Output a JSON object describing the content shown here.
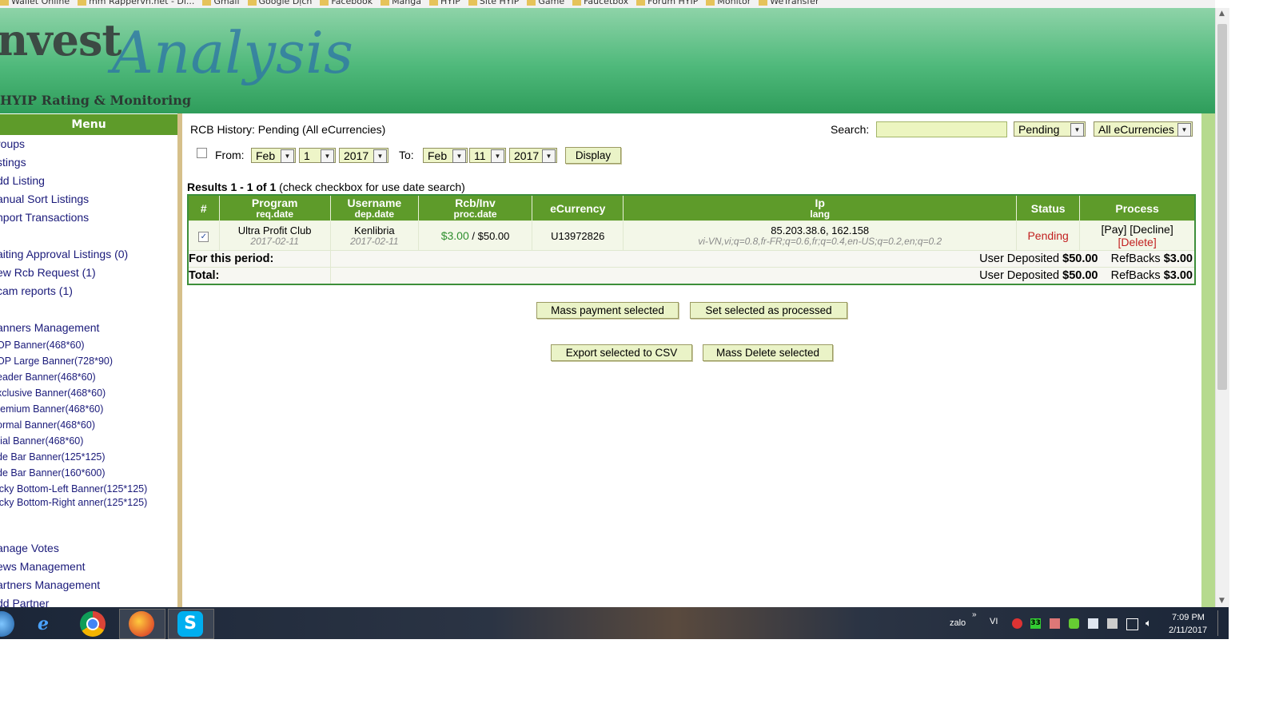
{
  "bookmarks": [
    "Wallet Online",
    "mm Rappervn.net - Di...",
    "Gmail",
    "Google Dịch",
    "Facebook",
    "Manga",
    "HYIP",
    "Site HYIP",
    "Game",
    "Faucetbox",
    "Forum HYIP",
    "Monitor",
    "WeTransfer"
  ],
  "logo": {
    "word": "nvest",
    "script": "Analysis",
    "tagline": "HYIP Rating & Monitoring"
  },
  "menu": {
    "title": "Menu",
    "items": [
      "roups",
      "stings",
      "dd Listing",
      "anual Sort Listings",
      "nport Transactions",
      "",
      "aiting Approval Listings (0)",
      "ew Rcb Request (1)",
      "cam reports (1)",
      "",
      "anners Management",
      "OP Banner(468*60)",
      "OP Large Banner(728*90)",
      "eader Banner(468*60)",
      "xclusive Banner(468*60)",
      "remium Banner(468*60)",
      "ormal Banner(468*60)",
      "rial Banner(468*60)",
      "de Bar Banner(125*125)",
      "de Bar Banner(160*600)",
      "icky Bottom-Left Banner(125*125)",
      "icky Bottom-Right anner(125*125)",
      "",
      "anage Votes",
      "ews Management",
      "artners Management",
      "dd Partner"
    ]
  },
  "page": {
    "title": "RCB History: Pending (All eCurrencies)",
    "search_label": "Search:",
    "search_value": "",
    "status_filter": "Pending",
    "currency_filter": "All eCurrencies",
    "from_label": "From:",
    "to_label": "To:",
    "from": {
      "month": "Feb",
      "day": "1",
      "year": "2017"
    },
    "to": {
      "month": "Feb",
      "day": "11",
      "year": "2017"
    },
    "display_button": "Display",
    "results_prefix": "Results",
    "results_range": "1 - 1 of 1",
    "results_note": "(check checkbox for use date search)"
  },
  "table": {
    "headers": {
      "num": "#",
      "program": "Program",
      "program_sub": "req.date",
      "username": "Username",
      "username_sub": "dep.date",
      "rcb": "Rcb/Inv",
      "rcb_sub": "proc.date",
      "ecurrency": "eCurrency",
      "ip": "Ip",
      "ip_sub": "lang",
      "status": "Status",
      "process": "Process"
    },
    "rows": [
      {
        "checked": true,
        "program": "Ultra Profit Club",
        "req_date": "2017-02-11",
        "username": "Kenlibria",
        "dep_date": "2017-02-11",
        "rcb": "$3.00",
        "inv": "$50.00",
        "ecurrency": "U13972826",
        "ip": "85.203.38.6, 162.158",
        "lang": "vi-VN,vi;q=0.8,fr-FR;q=0.6,fr;q=0.4,en-US;q=0.2,en;q=0.2",
        "status": "Pending",
        "pay": "[Pay]",
        "decline": "[Decline]",
        "delete": "[Delete]"
      }
    ],
    "period": {
      "label": "For this period:",
      "dep_label": "User Deposited",
      "dep_value": "$50.00",
      "ref_label": "RefBacks",
      "ref_value": "$3.00"
    },
    "total": {
      "label": "Total:",
      "dep_label": "User Deposited",
      "dep_value": "$50.00",
      "ref_label": "RefBacks",
      "ref_value": "$3.00"
    }
  },
  "actions": {
    "mass_payment": "Mass payment selected",
    "set_processed": "Set selected as processed",
    "export_csv": "Export selected to CSV",
    "mass_delete": "Mass Delete selected"
  },
  "taskbar": {
    "ime": "zalo",
    "lang": "VI",
    "badge": "33",
    "time": "7:09 PM",
    "date": "2/11/2017"
  },
  "colors": {
    "header_green": "#4fb97b",
    "menu_green": "#5e9b2a",
    "pending_red": "#c21f1f",
    "rcb_green": "#2f8f2f"
  }
}
